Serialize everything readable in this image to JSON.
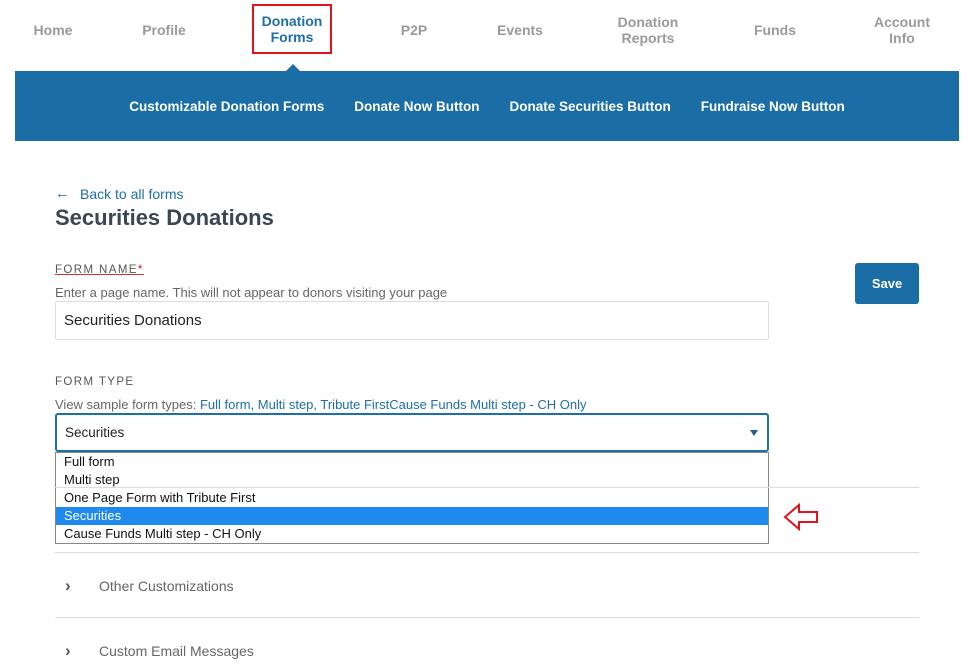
{
  "topnav": {
    "items": [
      {
        "line1": "Home",
        "line2": ""
      },
      {
        "line1": "Profile",
        "line2": ""
      },
      {
        "line1": "Donation",
        "line2": "Forms"
      },
      {
        "line1": "P2P",
        "line2": ""
      },
      {
        "line1": "Events",
        "line2": ""
      },
      {
        "line1": "Donation",
        "line2": "Reports"
      },
      {
        "line1": "Funds",
        "line2": ""
      },
      {
        "line1": "Account",
        "line2": "Info"
      }
    ],
    "active_index": 2
  },
  "subnav": {
    "items": [
      "Customizable Donation Forms",
      "Donate Now Button",
      "Donate Securities Button",
      "Fundraise Now Button"
    ]
  },
  "back_link": {
    "icon": "arrow-left-icon",
    "label": "Back to all forms"
  },
  "page_title": "Securities Donations",
  "save_label": "Save",
  "form_name": {
    "label": "FORM NAME",
    "required_mark": "*",
    "help": "Enter a page name. This will not appear to donors visiting your page",
    "value": "Securities Donations"
  },
  "form_type": {
    "label": "FORM TYPE",
    "help_prefix": "View sample form types: ",
    "help_links": "Full form, Multi step, Tribute FirstCause Funds Multi step - CH Only",
    "selected": "Securities",
    "options": [
      "Full form",
      "Multi step",
      "One Page Form with Tribute First",
      "Securities",
      "Cause Funds Multi step - CH Only"
    ],
    "selected_index": 3
  },
  "sections": [
    {
      "icon": "chevron-right-icon",
      "label": "Other Customizations"
    },
    {
      "icon": "chevron-right-icon",
      "label": "Custom Email Messages"
    }
  ],
  "colors": {
    "brand": "#1a6ea5",
    "highlight": "#1f8aee",
    "annotation": "#e0141c"
  }
}
